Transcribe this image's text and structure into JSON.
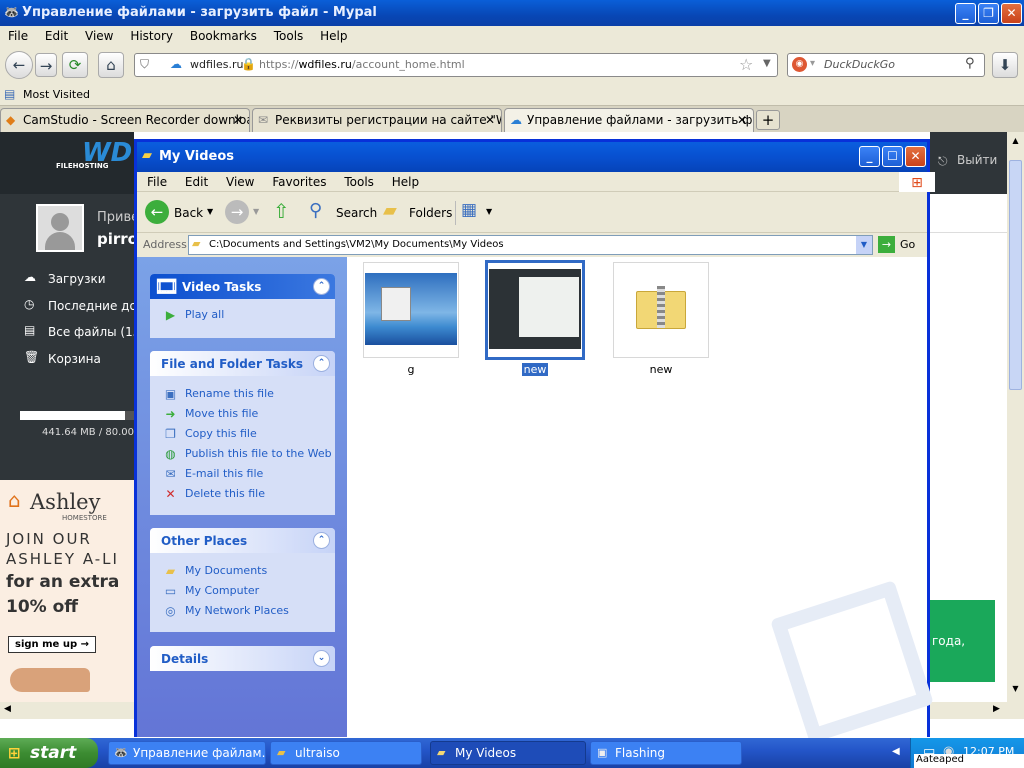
{
  "browser": {
    "title": "Управление файлами - загрузить файл - Mypal",
    "menu": [
      "File",
      "Edit",
      "View",
      "History",
      "Bookmarks",
      "Tools",
      "Help"
    ],
    "site_identity": "wdfiles.ru",
    "url_scheme": "https://",
    "url_host": "wdfiles.ru",
    "url_path": "/account_home.html",
    "search_placeholder": "DuckDuckGo",
    "bookmark": "Most Visited",
    "tabs": [
      {
        "label": "CamStudio - Screen Recorder download |..."
      },
      {
        "label": "Реквизиты регистрации на сайте \"WD..."
      },
      {
        "label": "Управление файлами - загрузить файл"
      }
    ]
  },
  "site": {
    "logo": "WD",
    "logo_sub": "FILEHOSTING",
    "logout": "Выйти",
    "greeting": "Приве",
    "username": "pirro",
    "nav": [
      "Загрузки",
      "Последние доб",
      "Все файлы (15",
      "Корзина"
    ],
    "storage": "441.64 MB / 80.00",
    "storage_fraction": 0.92,
    "ad_brand": "Ashley",
    "ad_brand_sub": "HOMESTORE",
    "ad_line1": "JOIN OUR",
    "ad_line2": "ASHLEY A-LI",
    "ad_line3": "for an extra",
    "ad_line4": "10% off",
    "ad_button": "sign me up →",
    "promo_text": "года,"
  },
  "explorer": {
    "title": "My Videos",
    "menu": [
      "File",
      "Edit",
      "View",
      "Favorites",
      "Tools",
      "Help"
    ],
    "toolbar": {
      "back": "Back",
      "search": "Search",
      "folders": "Folders"
    },
    "address_label": "Address",
    "address": "C:\\Documents and Settings\\VM2\\My Documents\\My Videos",
    "go": "Go",
    "video_tasks": {
      "title": "Video Tasks",
      "items": [
        "Play all"
      ]
    },
    "file_tasks": {
      "title": "File and Folder Tasks",
      "items": [
        "Rename this file",
        "Move this file",
        "Copy this file",
        "Publish this file to the Web",
        "E-mail this file",
        "Delete this file"
      ]
    },
    "other_places": {
      "title": "Other Places",
      "items": [
        "My Documents",
        "My Computer",
        "My Network Places"
      ]
    },
    "details": {
      "title": "Details"
    },
    "files": [
      {
        "name": "g",
        "type": "video-thumb"
      },
      {
        "name": "new",
        "type": "video-thumb",
        "selected": true
      },
      {
        "name": "new",
        "type": "zip-folder"
      }
    ]
  },
  "taskbar": {
    "start": "start",
    "items": [
      {
        "label": "Управление файлам..."
      },
      {
        "label": "ultraiso"
      },
      {
        "label": "My Videos"
      },
      {
        "label": "Flashing"
      }
    ],
    "clock": "12:07 PM",
    "tray_caption": "Aateaped"
  }
}
